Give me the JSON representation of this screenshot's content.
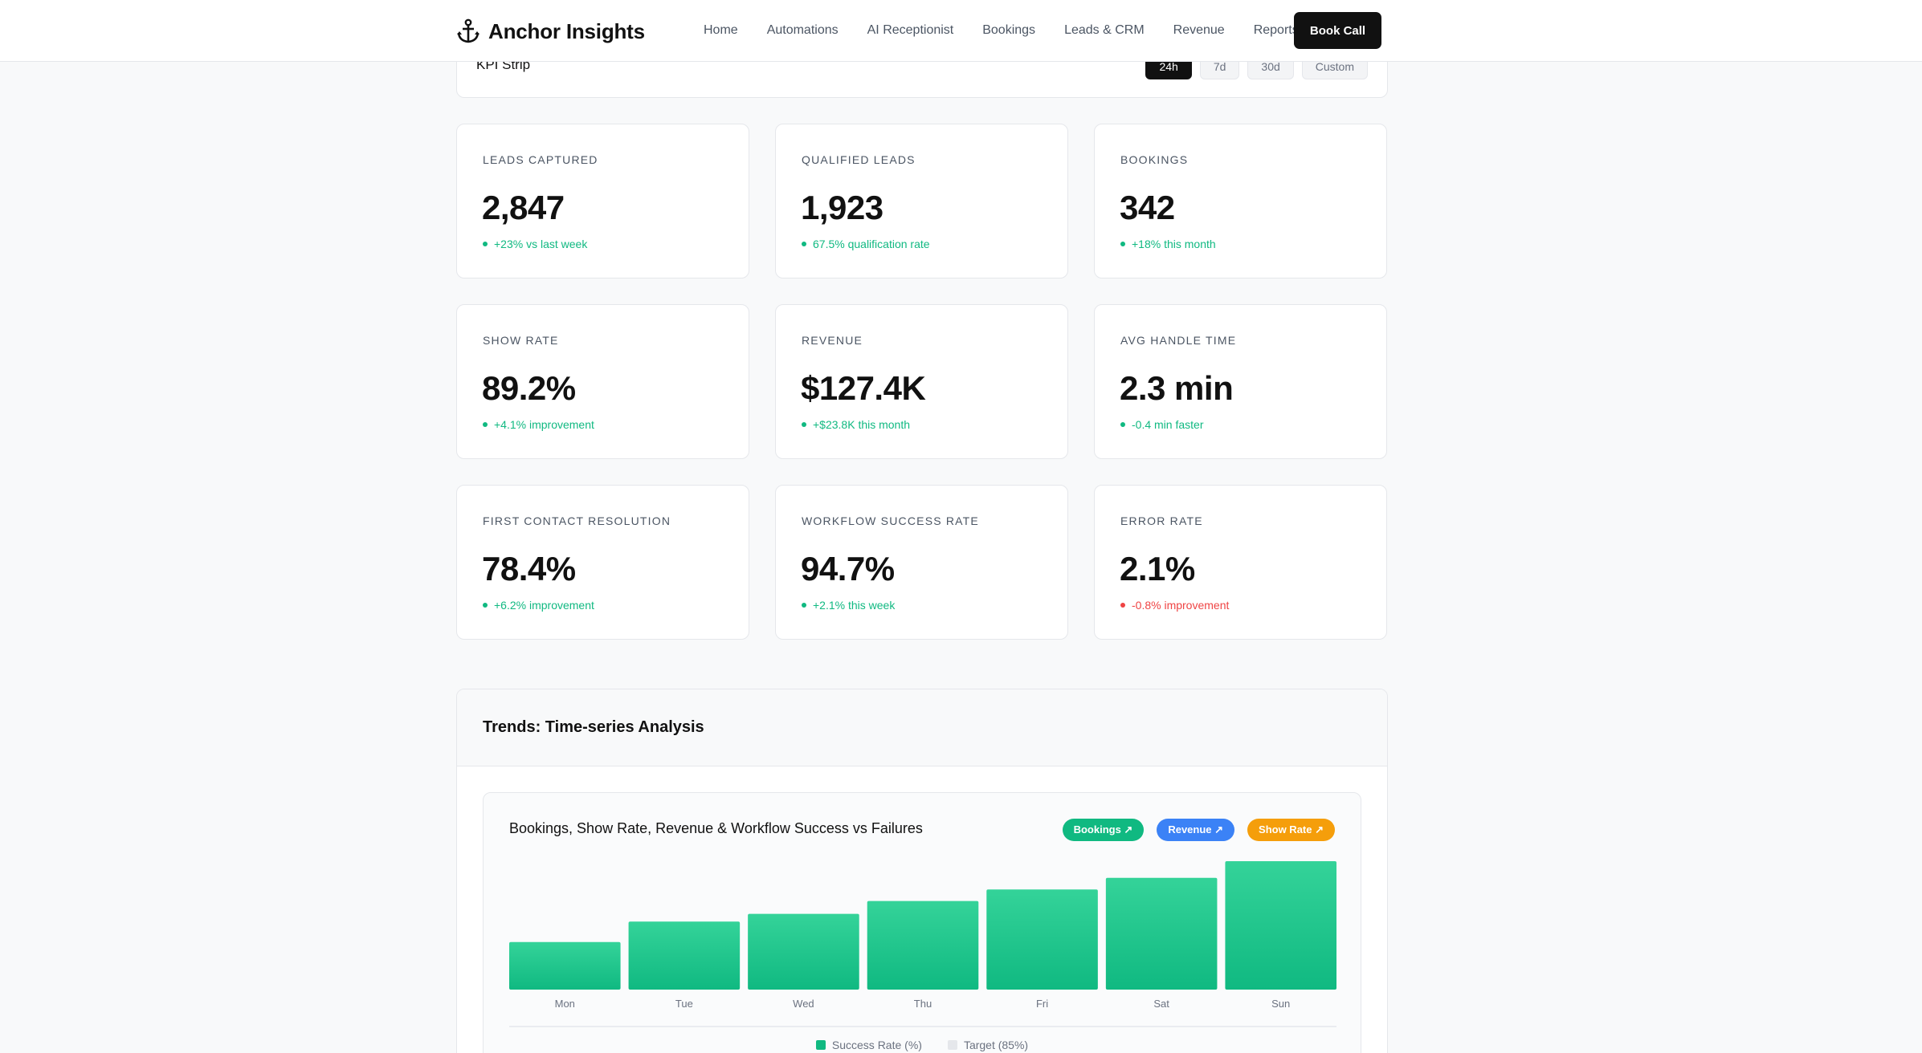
{
  "brand": {
    "name": "Anchor Insights"
  },
  "nav": {
    "links": [
      "Home",
      "Automations",
      "AI Receptionist",
      "Bookings",
      "Leads & CRM",
      "Revenue",
      "Reports"
    ],
    "cta": "Book Call"
  },
  "strip": {
    "title": "KPI Strip",
    "ranges": [
      "24h",
      "7d",
      "30d",
      "Custom"
    ],
    "active_range": "24h"
  },
  "kpis": [
    {
      "label": "LEADS CAPTURED",
      "value": "2,847",
      "delta": "+23% vs last week",
      "status": "positive"
    },
    {
      "label": "QUALIFIED LEADS",
      "value": "1,923",
      "delta": "67.5% qualification rate",
      "status": "positive"
    },
    {
      "label": "BOOKINGS",
      "value": "342",
      "delta": "+18% this month",
      "status": "positive"
    },
    {
      "label": "SHOW RATE",
      "value": "89.2%",
      "delta": "+4.1% improvement",
      "status": "positive"
    },
    {
      "label": "REVENUE",
      "value": "$127.4K",
      "delta": "+$23.8K this month",
      "status": "positive"
    },
    {
      "label": "AVG HANDLE TIME",
      "value": "2.3 min",
      "delta": "-0.4 min faster",
      "status": "positive"
    },
    {
      "label": "FIRST CONTACT RESOLUTION",
      "value": "78.4%",
      "delta": "+6.2% improvement",
      "status": "positive"
    },
    {
      "label": "WORKFLOW SUCCESS RATE",
      "value": "94.7%",
      "delta": "+2.1% this week",
      "status": "positive"
    },
    {
      "label": "ERROR RATE",
      "value": "2.1%",
      "delta": "-0.8% improvement",
      "status": "negative"
    }
  ],
  "trends": {
    "title": "Trends: Time-series Analysis",
    "chart_title": "Bookings, Show Rate, Revenue & Workflow Success vs Failures",
    "chips": [
      {
        "label": "Bookings ↗",
        "color": "#10b981"
      },
      {
        "label": "Revenue ↗",
        "color": "#3b82f6"
      },
      {
        "label": "Show Rate ↗",
        "color": "#f59e0b"
      }
    ]
  },
  "colors": {
    "positive": "#10b981",
    "negative": "#ef4444",
    "bar_top": "#34d399",
    "bar_bottom": "#10b981",
    "target": "#e5e7eb"
  },
  "chart_data": {
    "type": "bar",
    "categories": [
      "Mon",
      "Tue",
      "Wed",
      "Thu",
      "Fri",
      "Sat",
      "Sun"
    ],
    "series": [
      {
        "name": "Success Rate (%)",
        "values": [
          37,
          53,
          59,
          69,
          78,
          87,
          100
        ]
      },
      {
        "name": "Target (85%)",
        "values": []
      }
    ],
    "ylim": [
      0,
      100
    ],
    "legend": "bottom-center",
    "grid": false
  }
}
